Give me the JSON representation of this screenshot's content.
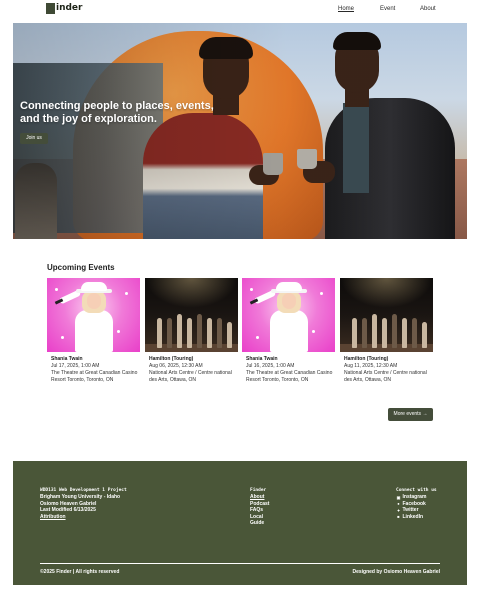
{
  "header": {
    "logo_text": "inder",
    "nav": [
      {
        "label": "Home"
      },
      {
        "label": "Event"
      },
      {
        "label": "About"
      }
    ]
  },
  "hero": {
    "title": "Connecting people to places, events, and the joy of exploration.",
    "button_label": "Join us"
  },
  "events": {
    "section_title": "Upcoming Events",
    "items": [
      {
        "name": "Shania Twain",
        "date": "Jul 17, 2025, 1:00 AM",
        "venue": "The Theatre at Great Canadian Casino Resort Toronto, Toronto, ON",
        "image": "shania-twain-photo"
      },
      {
        "name": "Hamilton (Touring)",
        "date": "Aug 06, 2025, 12:30 AM",
        "venue": "National Arts Centre / Centre national des Arts, Ottawa, ON",
        "image": "hamilton-stage-photo"
      },
      {
        "name": "Shania Twain",
        "date": "Jul 16, 2025, 1:00 AM",
        "venue": "The Theatre at Great Canadian Casino Resort Toronto, Toronto, ON",
        "image": "shania-twain-photo"
      },
      {
        "name": "Hamilton (Touring)",
        "date": "Aug 11, 2025, 12:30 AM",
        "venue": "National Arts Centre / Centre national des Arts, Ottawa, ON",
        "image": "hamilton-stage-photo"
      }
    ],
    "more_label": "More events →"
  },
  "footer": {
    "col1": {
      "course": "WDD131 Web Development 1 Project",
      "school": "Brigham Young University - Idaho",
      "author": "Osiomo Heaven Gabriel",
      "modified": "Last Modified 6/13/2025",
      "attribution": "Attribution"
    },
    "col2": {
      "heading": "Finder",
      "links": [
        "About",
        "Podcast",
        "FAQs",
        "Local",
        "Guide"
      ]
    },
    "col3": {
      "heading": "Connect with us",
      "links": [
        {
          "label": "Instagram",
          "icon": "instagram-icon"
        },
        {
          "label": "Facebook",
          "icon": "facebook-icon"
        },
        {
          "label": "Twitter",
          "icon": "twitter-icon"
        },
        {
          "label": "LinkedIn",
          "icon": "linkedin-icon"
        }
      ]
    },
    "copyright": "©2025 Finder | All rights reserved",
    "designed_by": "Designed by Osiomo Heaven Gabriel"
  },
  "colors": {
    "brand_dark_green": "#444d3a",
    "footer_green": "#4a5638",
    "white": "#ffffff"
  }
}
